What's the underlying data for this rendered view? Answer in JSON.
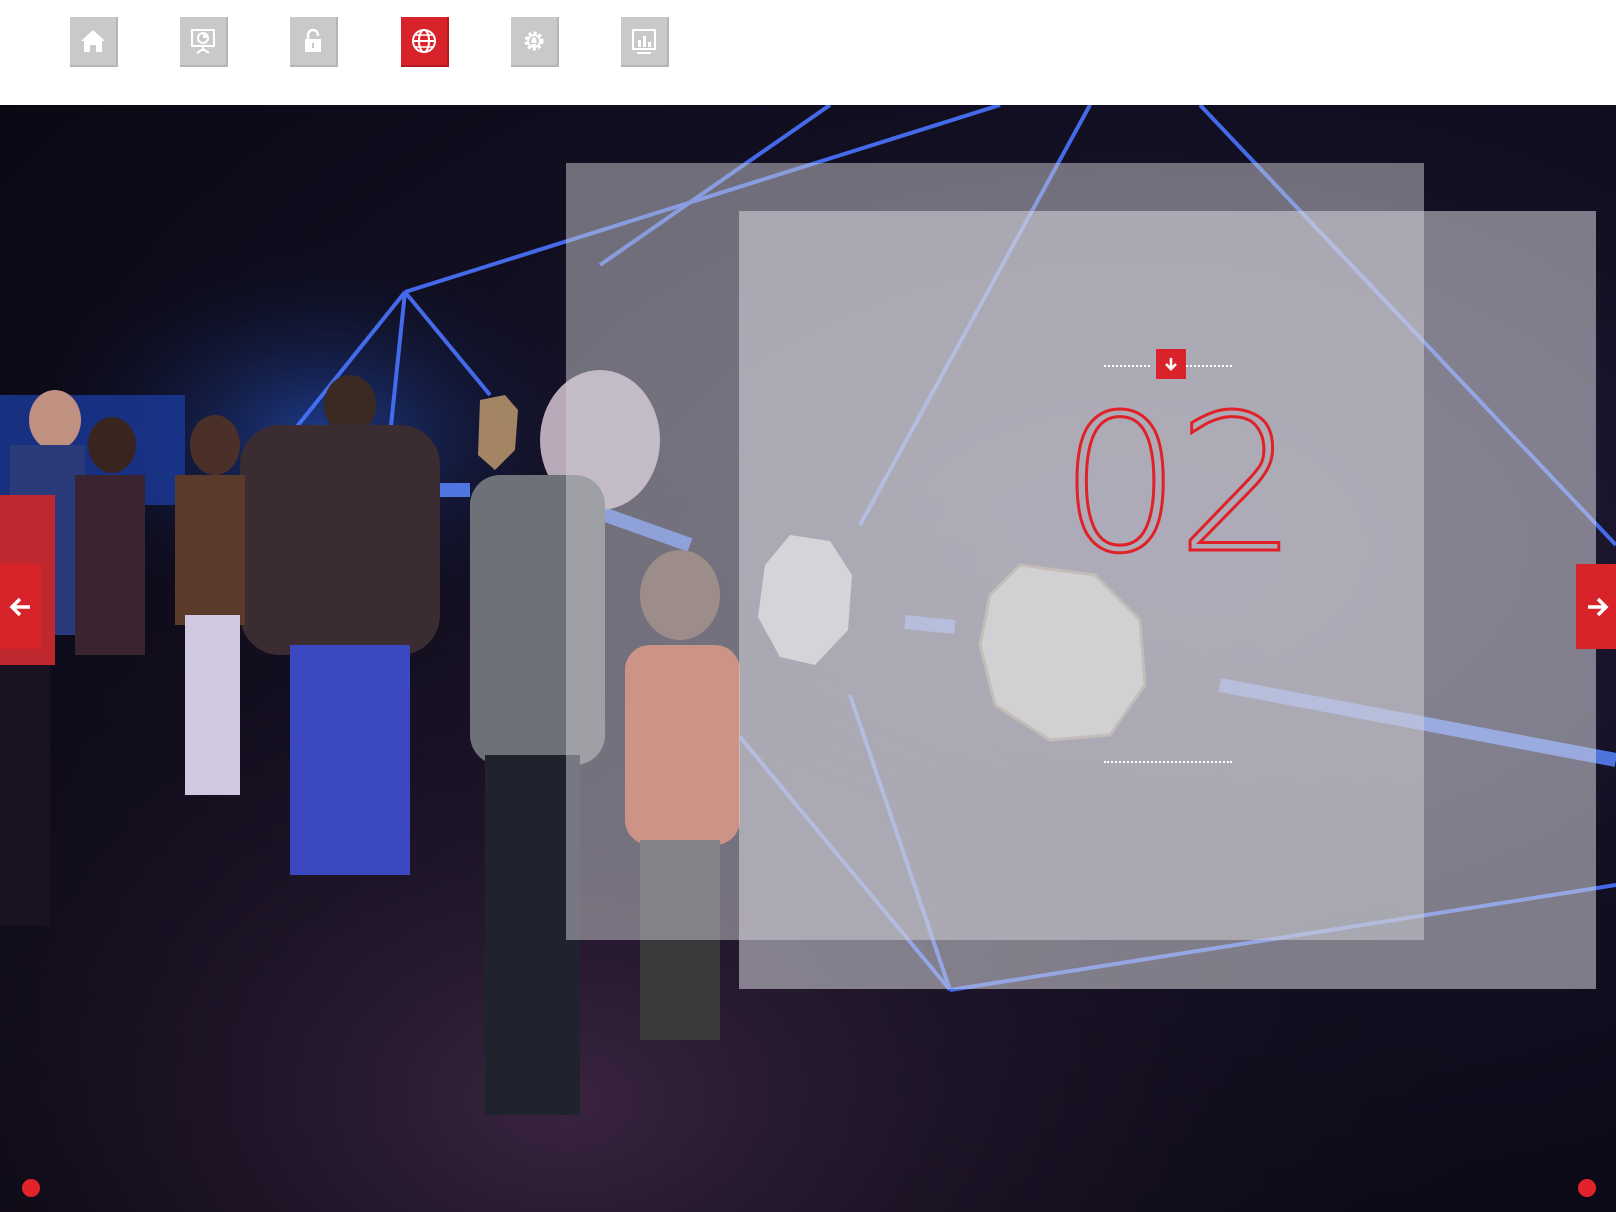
{
  "nav": {
    "items": [
      {
        "name": "home",
        "icon": "home-icon",
        "active": false
      },
      {
        "name": "presentation",
        "icon": "presentation-board-icon",
        "active": false
      },
      {
        "name": "lock",
        "icon": "lock-icon",
        "active": false
      },
      {
        "name": "globe",
        "icon": "globe-icon",
        "active": true
      },
      {
        "name": "settings",
        "icon": "gear-bulb-icon",
        "active": false
      },
      {
        "name": "stats",
        "icon": "bar-chart-icon",
        "active": false
      }
    ],
    "active_color": "#d9232a",
    "inactive_color": "#c9c9c9"
  },
  "slide": {
    "number": "02",
    "badge_icon": "arrow-down-icon"
  },
  "controls": {
    "prev_icon": "arrow-left-icon",
    "next_icon": "arrow-right-icon",
    "accent_color": "#d9232a"
  },
  "pager": {
    "dots": 2
  }
}
